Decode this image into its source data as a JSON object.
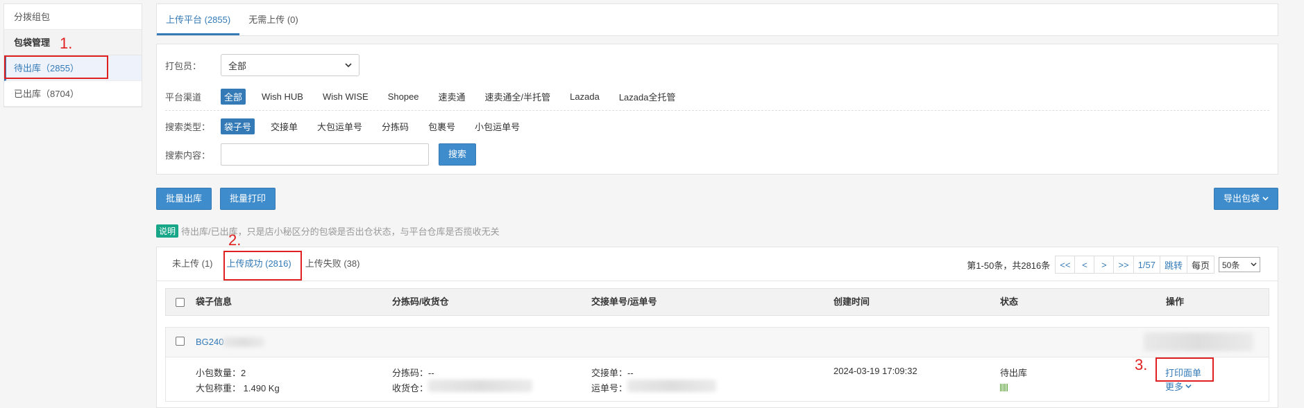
{
  "sidebar": {
    "items": [
      {
        "label": "分拨组包"
      },
      {
        "label": "包袋管理"
      },
      {
        "label": "待出库（2855）"
      },
      {
        "label": "已出库（8704）"
      }
    ]
  },
  "top_tabs": [
    {
      "label": "上传平台 (2855)"
    },
    {
      "label": "无需上传 (0)"
    }
  ],
  "filters": {
    "packer_label": "打包员：",
    "packer_value": "全部",
    "channel_label": "平台渠道",
    "channels": [
      "全部",
      "Wish HUB",
      "Wish WISE",
      "Shopee",
      "速卖通",
      "速卖通全/半托管",
      "Lazada",
      "Lazada全托管"
    ],
    "search_type_label": "搜索类型：",
    "search_types": [
      "袋子号",
      "交接单",
      "大包运单号",
      "分拣码",
      "包裹号",
      "小包运单号"
    ],
    "search_content_label": "搜索内容：",
    "search_value": "",
    "search_button": "搜索"
  },
  "actions": {
    "batch_out": "批量出库",
    "batch_print": "批量打印",
    "export": "导出包袋"
  },
  "note": {
    "badge": "说明",
    "text": "待出库/已出库，只是店小秘区分的包袋是否出仓状态，与平台仓库是否揽收无关"
  },
  "result_tabs": [
    {
      "label": "未上传 (1)"
    },
    {
      "label": "上传成功 (2816)"
    },
    {
      "label": "上传失败 (38)"
    }
  ],
  "pager": {
    "info": "第1-50条，共2816条",
    "first": "<<",
    "prev": "<",
    "next": ">",
    "last": ">>",
    "page": "1/57",
    "jump": "跳转",
    "per_page_label": "每页",
    "per_page_value": "50条"
  },
  "table": {
    "headers": [
      "袋子信息",
      "分拣码/收货仓",
      "交接单号/运单号",
      "创建时间",
      "状态",
      "操作"
    ]
  },
  "row": {
    "bag_id": "BG240",
    "small_count_label": "小包数量：",
    "small_count": "2",
    "weight_label": "大包称重：",
    "weight": "1.490 Kg",
    "sort_code_label": "分拣码：",
    "sort_code": "--",
    "warehouse_label": "收货仓：",
    "handover_label": "交接单：",
    "handover": "--",
    "waybill_label": "运单号：",
    "created": "2024-03-19 17:09:32",
    "status": "待出库",
    "status_bar_color": "#5aa13a",
    "print_link": "打印面单",
    "more_link": "更多"
  },
  "annotations": {
    "step1": "1.",
    "step2": "2.",
    "step3": "3."
  },
  "colors": {
    "primary": "#337ab7",
    "button": "#3f8ccc",
    "note_badge": "#18a689",
    "annotation": "#e02020"
  }
}
